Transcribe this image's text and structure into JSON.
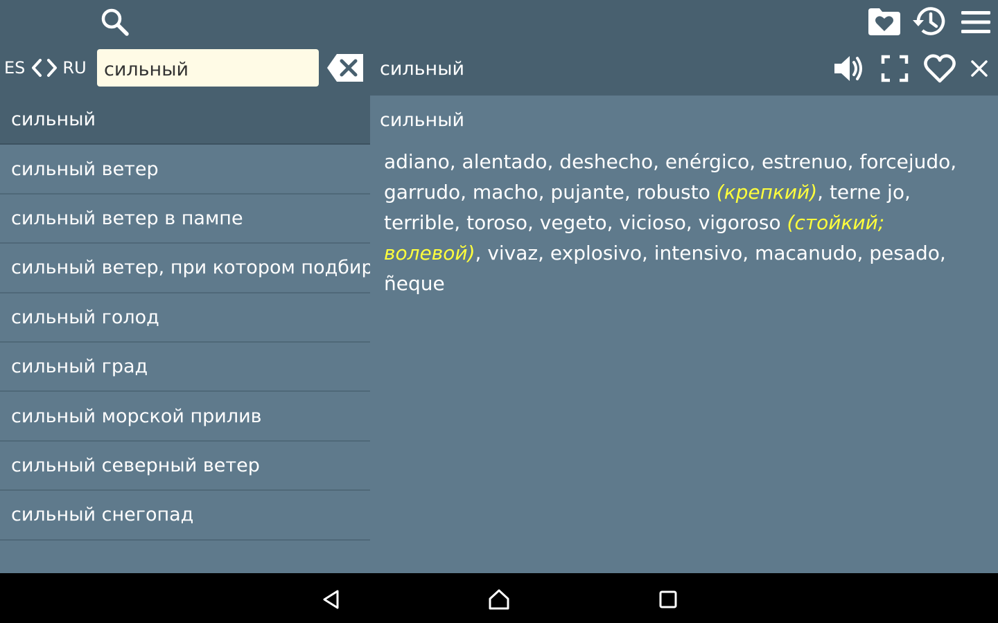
{
  "toolbar": {
    "search_icon": "search-icon",
    "favorites_folder_icon": "favorites-folder-icon",
    "history_icon": "history-icon",
    "menu_icon": "menu-icon"
  },
  "language_switch": {
    "source": "ES",
    "target": "RU"
  },
  "search": {
    "value": "сильный",
    "placeholder": ""
  },
  "article_header": {
    "word": "сильный",
    "actions": [
      "speaker-icon",
      "fullscreen-icon",
      "heart-icon",
      "close-icon"
    ]
  },
  "word_list": {
    "items": [
      {
        "label": "сильный",
        "selected": true
      },
      {
        "label": "сильный ветер",
        "selected": false
      },
      {
        "label": "сильный ветер в пампе",
        "selected": false
      },
      {
        "label": "сильный ветер, при котором подбирают паруса",
        "selected": false
      },
      {
        "label": "сильный голод",
        "selected": false
      },
      {
        "label": "сильный град",
        "selected": false
      },
      {
        "label": "сильный морской прилив",
        "selected": false
      },
      {
        "label": "сильный северный ветер",
        "selected": false
      },
      {
        "label": "сильный снегопад",
        "selected": false
      }
    ]
  },
  "article": {
    "title": "сильный",
    "segments": [
      {
        "text": "adiano, alentado, deshecho, enérgico, estrenuo, forcejudo, garrudo, macho, pujante, robusto ",
        "note": false
      },
      {
        "text": "(крепкий)",
        "note": true
      },
      {
        "text": ", terne jo, terrible, toroso, vegeto, vicioso, vigoroso ",
        "note": false
      },
      {
        "text": "(стойкий; волевой)",
        "note": true
      },
      {
        "text": ", vivaz, explosivo, intensivo, macanudo, pesado, ñeque",
        "note": false
      }
    ]
  },
  "colors": {
    "toolbar_bg": "#48606f",
    "content_bg": "#5f7a8c",
    "search_field_bg": "#fffbe6",
    "note_color": "#ffff3c",
    "nav_bar_bg": "#000000"
  },
  "nav_bar": {
    "buttons": [
      "back-icon",
      "home-icon",
      "recents-icon"
    ]
  }
}
